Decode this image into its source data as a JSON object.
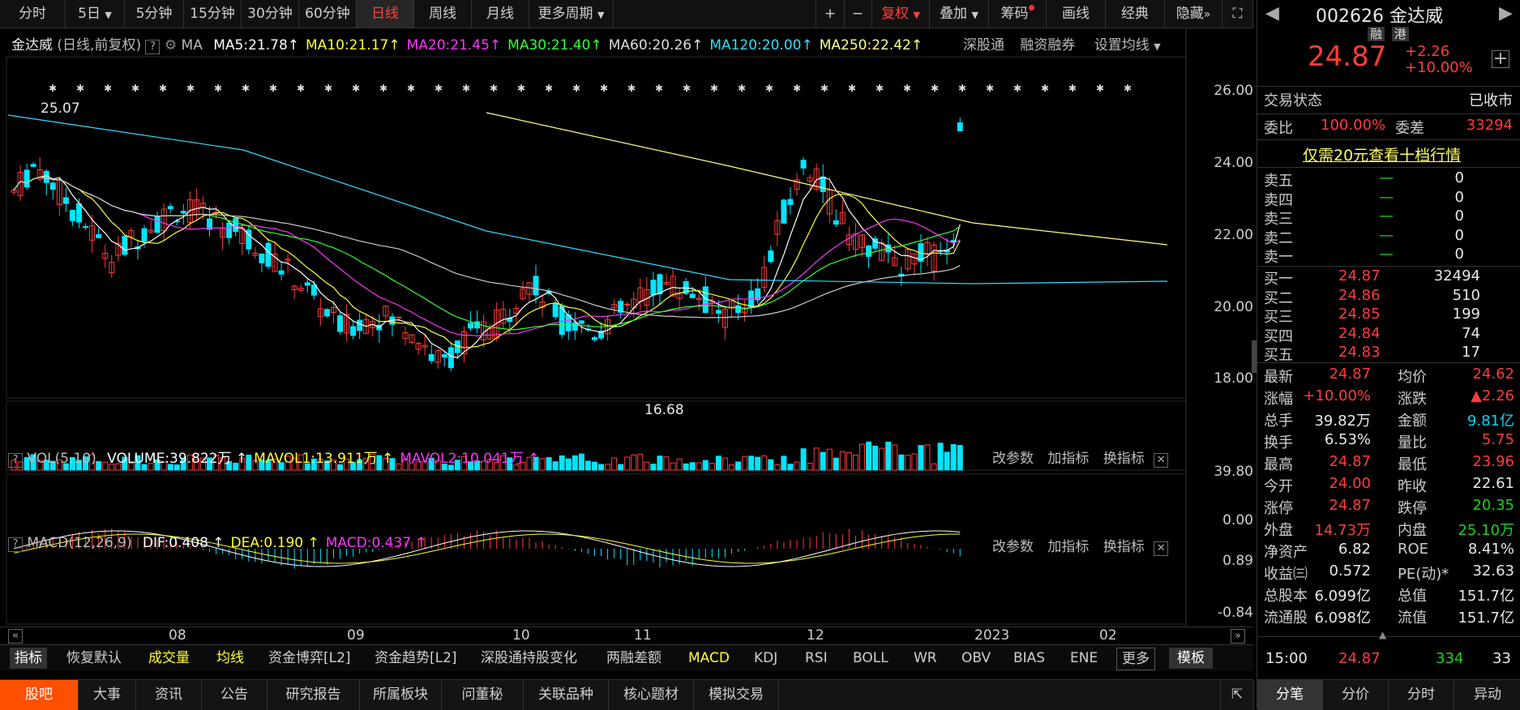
{
  "toolbar": {
    "periods": [
      "分时",
      "5日",
      "5分钟",
      "15分钟",
      "30分钟",
      "60分钟",
      "日线",
      "周线",
      "月线",
      "更多周期"
    ],
    "active_period": "日线",
    "tools": [
      "复权",
      "叠加",
      "筹码",
      "画线",
      "经典",
      "隐藏"
    ],
    "plus": "+",
    "minus": "−"
  },
  "main_chart": {
    "title": "金达威",
    "subtitle": "(日线,前复权)",
    "ma_label": "MA",
    "ma_items": [
      {
        "text": "MA5:21.78",
        "color": "#ffffff"
      },
      {
        "text": "MA10:21.17",
        "color": "#ffff33"
      },
      {
        "text": "MA20:21.45",
        "color": "#ff33ff"
      },
      {
        "text": "MA30:21.40",
        "color": "#33ff33"
      },
      {
        "text": "MA60:20.26",
        "color": "#dddddd"
      },
      {
        "text": "MA120:20.00",
        "color": "#33ddff"
      },
      {
        "text": "MA250:22.42",
        "color": "#ffff88"
      }
    ],
    "links": [
      "深股通",
      "融资融券",
      "设置均线"
    ],
    "high_label": "25.07",
    "low_label": "16.68",
    "y_ticks": [
      "26.00",
      "24.00",
      "22.00",
      "20.00",
      "18.00"
    ]
  },
  "volume_panel": {
    "label": "VOL(5,10)",
    "items": [
      {
        "text": "VOLUME:39.822万",
        "color": "#ffffff"
      },
      {
        "text": "MAVOL1:13.911万",
        "color": "#ffff33"
      },
      {
        "text": "MAVOL2:10.041万",
        "color": "#ff33ff"
      }
    ],
    "actions": [
      "改参数",
      "加指标",
      "换指标"
    ],
    "y_ticks": [
      "39.80",
      "0.00"
    ]
  },
  "macd_panel": {
    "label": "MACD(12,26,9)",
    "items": [
      {
        "text": "DIF:0.408",
        "color": "#ffffff"
      },
      {
        "text": "DEA:0.190",
        "color": "#ffff33"
      },
      {
        "text": "MACD:0.437",
        "color": "#ff33ff"
      }
    ],
    "actions": [
      "改参数",
      "加指标",
      "换指标"
    ],
    "y_ticks": [
      "0.89",
      "-0.84"
    ]
  },
  "x_axis": [
    "08",
    "09",
    "10",
    "11",
    "12",
    "2023",
    "02"
  ],
  "indicator_bar": {
    "items": [
      "指标",
      "恢复默认",
      "成交量",
      "均线",
      "资金博弈[L2]",
      "资金趋势[L2]",
      "深股通持股变化",
      "两融差额",
      "MACD",
      "KDJ",
      "RSI",
      "BOLL",
      "WR",
      "OBV",
      "BIAS",
      "ENE",
      "更多"
    ],
    "template": "模板"
  },
  "bottom_tabs": [
    "股吧",
    "大事",
    "资讯",
    "公告",
    "研究报告",
    "所属板块",
    "问董秘",
    "关联品种",
    "核心题材",
    "模拟交易"
  ],
  "quote": {
    "code": "002626",
    "name": "金达威",
    "badges": [
      "融",
      "港"
    ],
    "price": "24.87",
    "change": "+2.26",
    "change_pct": "+10.00%",
    "trade_status_label": "交易状态",
    "trade_status": "已收市",
    "weibi_label": "委比",
    "weibi": "100.00%",
    "weicha_label": "委差",
    "weicha": "33294",
    "promo": "仅需20元查看十档行情",
    "asks": [
      {
        "label": "卖五",
        "price": "—",
        "vol": "0"
      },
      {
        "label": "卖四",
        "price": "—",
        "vol": "0"
      },
      {
        "label": "卖三",
        "price": "—",
        "vol": "0"
      },
      {
        "label": "卖二",
        "price": "—",
        "vol": "0"
      },
      {
        "label": "卖一",
        "price": "—",
        "vol": "0"
      }
    ],
    "bids": [
      {
        "label": "买一",
        "price": "24.87",
        "vol": "32494"
      },
      {
        "label": "买二",
        "price": "24.86",
        "vol": "510"
      },
      {
        "label": "买三",
        "price": "24.85",
        "vol": "199"
      },
      {
        "label": "买四",
        "price": "24.84",
        "vol": "74"
      },
      {
        "label": "买五",
        "price": "24.83",
        "vol": "17"
      }
    ],
    "stats": [
      {
        "l1": "最新",
        "v1": "24.87",
        "c1": "red",
        "l2": "均价",
        "v2": "24.62",
        "c2": "red"
      },
      {
        "l1": "涨幅",
        "v1": "+10.00%",
        "c1": "red",
        "l2": "涨跌",
        "v2": "▲2.26",
        "c2": "red"
      },
      {
        "l1": "总手",
        "v1": "39.82万",
        "c1": "white",
        "l2": "金额",
        "v2": "9.81亿",
        "c2": "cyan"
      },
      {
        "l1": "换手",
        "v1": "6.53%",
        "c1": "white",
        "l2": "量比",
        "v2": "5.75",
        "c2": "red"
      },
      {
        "l1": "最高",
        "v1": "24.87",
        "c1": "red",
        "l2": "最低",
        "v2": "23.96",
        "c2": "red"
      },
      {
        "l1": "今开",
        "v1": "24.00",
        "c1": "red",
        "l2": "昨收",
        "v2": "22.61",
        "c2": "white"
      },
      {
        "l1": "涨停",
        "v1": "24.87",
        "c1": "red",
        "l2": "跌停",
        "v2": "20.35",
        "c2": "green"
      },
      {
        "l1": "外盘",
        "v1": "14.73万",
        "c1": "red",
        "l2": "内盘",
        "v2": "25.10万",
        "c2": "green"
      },
      {
        "l1": "净资产",
        "v1": "6.82",
        "c1": "white",
        "l2": "ROE",
        "v2": "8.41%",
        "c2": "white"
      },
      {
        "l1": "收益㈢",
        "v1": "0.572",
        "c1": "white",
        "l2": "PE(动)*",
        "v2": "32.63",
        "c2": "white"
      },
      {
        "l1": "总股本",
        "v1": "6.099亿",
        "c1": "white",
        "l2": "总值",
        "v2": "151.7亿",
        "c2": "white"
      },
      {
        "l1": "流通股",
        "v1": "6.098亿",
        "c1": "white",
        "l2": "流值",
        "v2": "151.7亿",
        "c2": "white"
      }
    ],
    "tick": {
      "time": "15:00",
      "price": "24.87",
      "vol": "334",
      "num": "33"
    },
    "tabs": [
      "分笔",
      "分价",
      "分时",
      "异动"
    ]
  }
}
